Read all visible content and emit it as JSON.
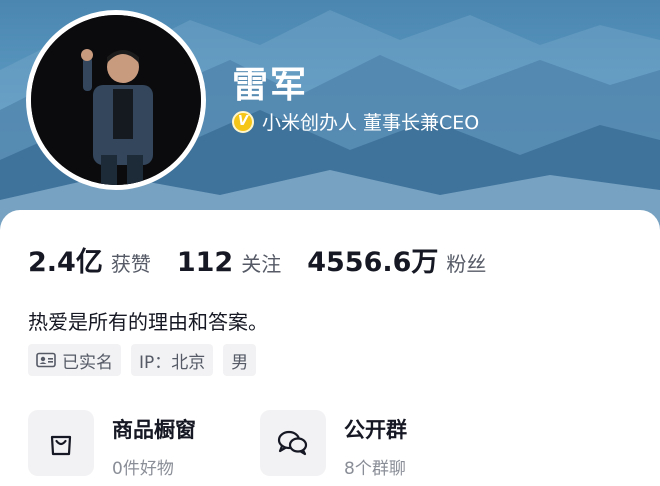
{
  "profile": {
    "name": "雷军",
    "verification": "小米创办人 董事长兼CEO",
    "verified_badge_letter": "V",
    "bio": "热爱是所有的理由和答案。"
  },
  "stats": [
    {
      "value": "2.4亿",
      "label": "获赞"
    },
    {
      "value": "112",
      "label": "关注"
    },
    {
      "value": "4556.6万",
      "label": "粉丝"
    }
  ],
  "tags": [
    {
      "label": "已实名",
      "icon": "id-card-icon"
    },
    {
      "label": "IP：北京"
    },
    {
      "label": "男"
    }
  ],
  "features": [
    {
      "title": "商品橱窗",
      "subtitle": "0件好物",
      "icon": "shopping-bag-icon"
    },
    {
      "title": "公开群",
      "subtitle": "8个群聊",
      "icon": "chat-bubbles-icon"
    }
  ],
  "colors": {
    "badge": "#f5c518",
    "text_primary": "#161823",
    "text_secondary": "#555a66",
    "tag_bg": "#f2f2f4"
  }
}
